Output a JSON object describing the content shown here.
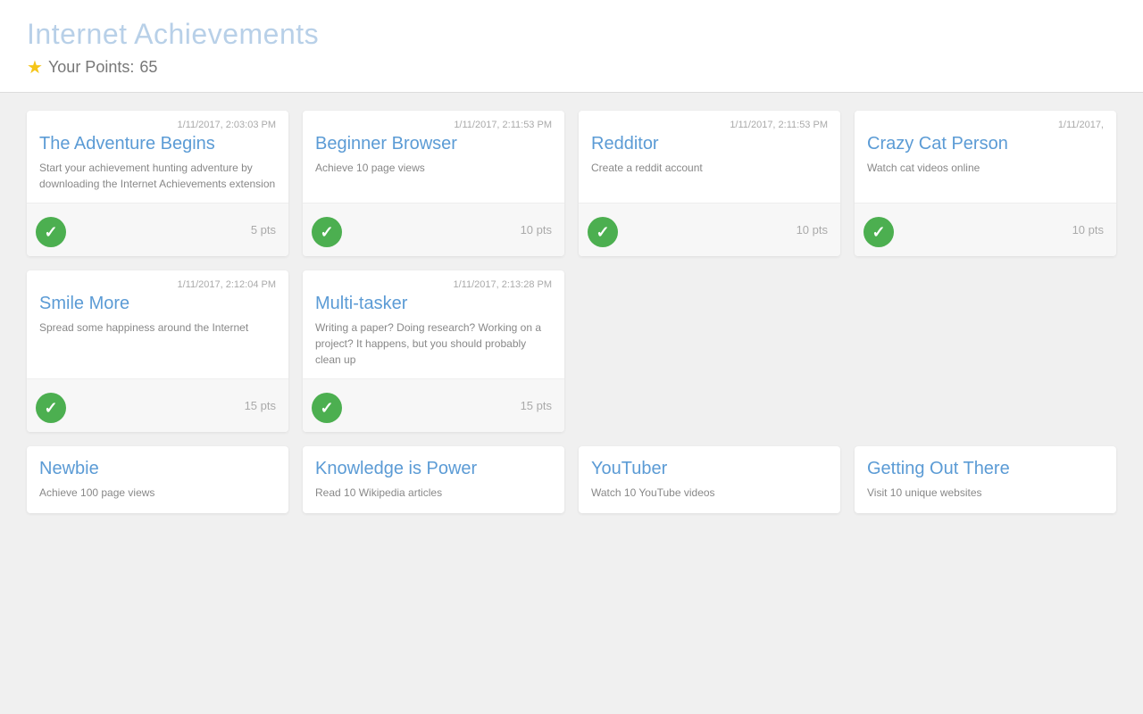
{
  "header": {
    "title_part1": "Internet",
    "title_part2": " Achievements",
    "points_label": "Your Points:",
    "points_value": "65"
  },
  "completed_cards": [
    {
      "date": "1/11/2017, 2:03:03 PM",
      "title": "The Adventure Begins",
      "desc": "Start your achievement hunting adventure by downloading the Internet Achievements extension",
      "points": "5 pts"
    },
    {
      "date": "1/11/2017, 2:11:53 PM",
      "title": "Beginner Browser",
      "desc": "Achieve 10 page views",
      "points": "10 pts"
    },
    {
      "date": "1/11/2017, 2:11:53 PM",
      "title": "Redditor",
      "desc": "Create a reddit account",
      "points": "10 pts"
    },
    {
      "date": "1/11/2017,",
      "title": "Crazy Cat Person",
      "desc": "Watch cat videos online",
      "points": "10 pts"
    }
  ],
  "completed_row2": [
    {
      "date": "1/11/2017, 2:12:04 PM",
      "title": "Smile More",
      "desc": "Spread some happiness around the Internet",
      "points": "15 pts"
    },
    {
      "date": "1/11/2017, 2:13:28 PM",
      "title": "Multi-tasker",
      "desc": "Writing a paper? Doing research? Working on a project? It happens, but you should probably clean up",
      "points": "15 pts"
    }
  ],
  "incomplete_cards": [
    {
      "title": "Newbie",
      "desc": "Achieve 100 page views"
    },
    {
      "title": "Knowledge is Power",
      "desc": "Read 10 Wikipedia articles"
    },
    {
      "title": "YouTuber",
      "desc": "Watch 10 YouTube videos"
    },
    {
      "title": "Getting Out There",
      "desc": "Visit 10 unique websites"
    }
  ]
}
